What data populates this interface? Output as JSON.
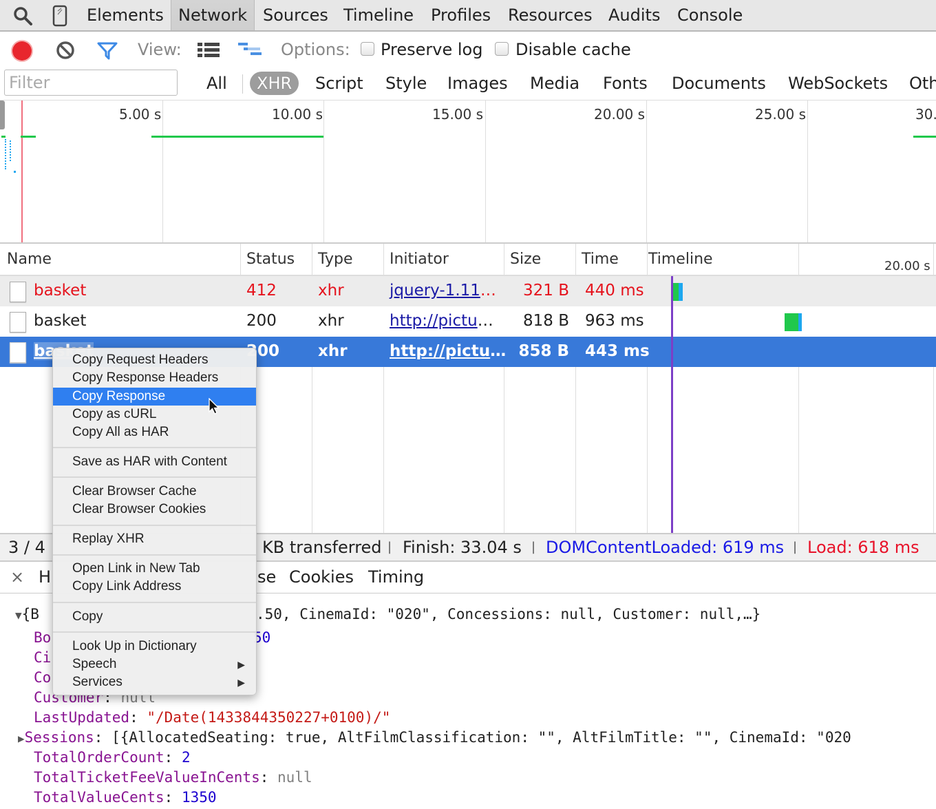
{
  "tabs": [
    {
      "label": "Elements",
      "active": false
    },
    {
      "label": "Network",
      "active": true
    },
    {
      "label": "Sources",
      "active": false
    },
    {
      "label": "Timeline",
      "active": false
    },
    {
      "label": "Profiles",
      "active": false
    },
    {
      "label": "Resources",
      "active": false
    },
    {
      "label": "Audits",
      "active": false
    },
    {
      "label": "Console",
      "active": false
    }
  ],
  "icons": {
    "search": "search-icon",
    "device": "device-mode-icon",
    "record": "record-icon",
    "clear": "clear-icon",
    "filter": "filter-icon",
    "large_rows": "list-view-icon",
    "overview": "waterfall-view-icon"
  },
  "toolbar": {
    "view_label": "View:",
    "options_label": "Options:",
    "preserve_log": {
      "label": "Preserve log",
      "checked": false
    },
    "disable_cache": {
      "label": "Disable cache",
      "checked": false
    }
  },
  "filter": {
    "placeholder": "Filter",
    "value": "",
    "types": [
      {
        "label": "All",
        "active": false
      },
      {
        "label": "XHR",
        "active": true
      },
      {
        "label": "Script",
        "active": false
      },
      {
        "label": "Style",
        "active": false
      },
      {
        "label": "Images",
        "active": false
      },
      {
        "label": "Media",
        "active": false
      },
      {
        "label": "Fonts",
        "active": false
      },
      {
        "label": "Documents",
        "active": false
      },
      {
        "label": "WebSockets",
        "active": false
      },
      {
        "label": "Oth",
        "active": false
      }
    ]
  },
  "overview": {
    "tick_labels": [
      "5.00 s",
      "10.00 s",
      "15.00 s",
      "20.00 s",
      "25.00 s",
      "30."
    ]
  },
  "table": {
    "columns": [
      "Name",
      "Status",
      "Type",
      "Initiator",
      "Size",
      "Time",
      "Timeline"
    ],
    "timeline_tick": "20.00 s",
    "rows": [
      {
        "name": "basket",
        "status": "412",
        "type": "xhr",
        "initiator": "jquery-1.11",
        "initiator_ellipsis": "…",
        "size": "321 B",
        "time": "440 ms",
        "error": true,
        "selected": false
      },
      {
        "name": "basket",
        "status": "200",
        "type": "xhr",
        "initiator": "http://pictu",
        "initiator_ellipsis": "…",
        "size": "818 B",
        "time": "963 ms",
        "error": false,
        "selected": false
      },
      {
        "name": "basket",
        "status": "200",
        "type": "xhr",
        "initiator": "http://pictu",
        "initiator_ellipsis": "…",
        "size": "858 B",
        "time": "443 ms",
        "error": false,
        "selected": true
      }
    ]
  },
  "status": {
    "count": "3 / 4",
    "transferred": "KB transferred",
    "sep": "|",
    "finish": "Finish: 33.04 s",
    "dom_content_loaded": "DOMContentLoaded: 619 ms",
    "load": "Load: 618 ms"
  },
  "detail": {
    "close": "×",
    "tabs_visible": [
      "H",
      "se",
      "Cookies",
      "Timing"
    ]
  },
  "preview": {
    "summary_open": "{B",
    "summary_rest": ".50, CinemaId: \"020\", Concessions: null, Customer: null,…}",
    "bo_key": "Bo",
    "bo_val": "50",
    "ci_key": "Ci",
    "co_key": "Co",
    "customer_key": "Customer",
    "customer_val": "null",
    "lastupdated_key": "LastUpdated",
    "lastupdated_val": "\"/Date(1433844350227+0100)/\"",
    "sessions_key": "Sessions",
    "sessions_val": "[{AllocatedSeating: true, AltFilmClassification: \"\", AltFilmTitle: \"\", CinemaId: \"020",
    "totalordercount_key": "TotalOrderCount",
    "totalordercount_val": "2",
    "ticketfee_key": "TotalTicketFeeValueInCents",
    "ticketfee_val": "null",
    "totalvalue_key": "TotalValueCents",
    "totalvalue_val": "1350"
  },
  "context_menu": {
    "items": [
      {
        "label": "Copy Request Headers"
      },
      {
        "label": "Copy Response Headers"
      },
      {
        "label": "Copy Response",
        "highlighted": true
      },
      {
        "label": "Copy as cURL"
      },
      {
        "label": "Copy All as HAR"
      },
      {
        "label": "Save as HAR with Content"
      },
      {
        "label": "Clear Browser Cache"
      },
      {
        "label": "Clear Browser Cookies"
      },
      {
        "label": "Replay XHR"
      },
      {
        "label": "Open Link in New Tab"
      },
      {
        "label": "Copy Link Address"
      },
      {
        "label": "Copy"
      },
      {
        "label": "Look Up in Dictionary"
      },
      {
        "label": "Speech",
        "submenu": true
      },
      {
        "label": "Services",
        "submenu": true
      }
    ],
    "submenu_arrow": "▶"
  },
  "colors": {
    "accent_blue": "#3879d9",
    "error_red": "#e5131d",
    "dcl_blue": "#1a1ae6",
    "load_red": "#e8132a",
    "waiting_green": "#20c84c",
    "receiving_blue": "#1ea7f0",
    "dcl_line": "#7c3fc7",
    "load_line": "#f0707f"
  }
}
